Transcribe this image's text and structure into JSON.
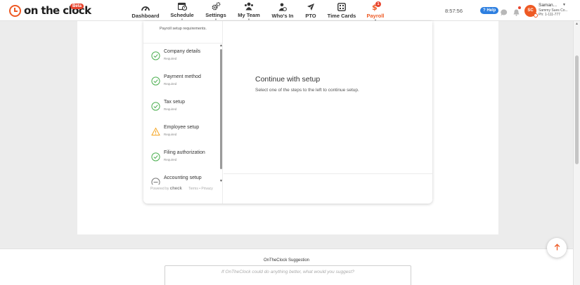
{
  "app": {
    "logo_text": "on the clock",
    "beta_label": "Beta"
  },
  "nav": {
    "items": [
      {
        "label": "Dashboard",
        "icon": "dashboard-gauge-icon"
      },
      {
        "label": "Schedule",
        "icon": "calendar-clock-icon"
      },
      {
        "label": "Settings",
        "icon": "gears-icon"
      },
      {
        "label": "My Team",
        "icon": "team-icon"
      },
      {
        "label": "Who's In",
        "icon": "person-clock-icon"
      },
      {
        "label": "PTO",
        "icon": "airplane-icon"
      },
      {
        "label": "Time Cards",
        "icon": "time-card-icon"
      },
      {
        "label": "Payroll",
        "icon": "payroll-dollar-icon",
        "badge": "1",
        "active": true
      }
    ]
  },
  "header": {
    "time": "8:57:56",
    "help_label": "? Help",
    "avatar_initials": "SC",
    "user_name": "Saman...",
    "user_company": "Sammy Sues Co...",
    "user_phone": "Ph: 1-111-777"
  },
  "setup": {
    "intro": "Payroll setup requirements.",
    "steps": [
      {
        "title": "Company details",
        "status": "Required",
        "state": "complete"
      },
      {
        "title": "Payment method",
        "status": "Required",
        "state": "complete"
      },
      {
        "title": "Tax setup",
        "status": "Required",
        "state": "complete"
      },
      {
        "title": "Employee setup",
        "status": "Required",
        "state": "warning"
      },
      {
        "title": "Filing authorization",
        "status": "Required",
        "state": "complete"
      },
      {
        "title": "Accounting setup",
        "status": "",
        "state": "pending"
      }
    ],
    "powered_by": "Powered by",
    "powered_brand": "check",
    "terms_label": "Terms",
    "separator": "•",
    "privacy_label": "Privacy"
  },
  "detail": {
    "title": "Continue with setup",
    "text": "Select one of the steps to the left to continue setup."
  },
  "suggestion": {
    "label": "OnTheClock Suggestion",
    "placeholder": "If OnTheClock could do anything better, what would you suggest?"
  },
  "colors": {
    "brand_orange": "#ee5a24",
    "success_green": "#4caf50",
    "warning_orange": "#f5a623",
    "help_blue": "#2d7fe0"
  }
}
